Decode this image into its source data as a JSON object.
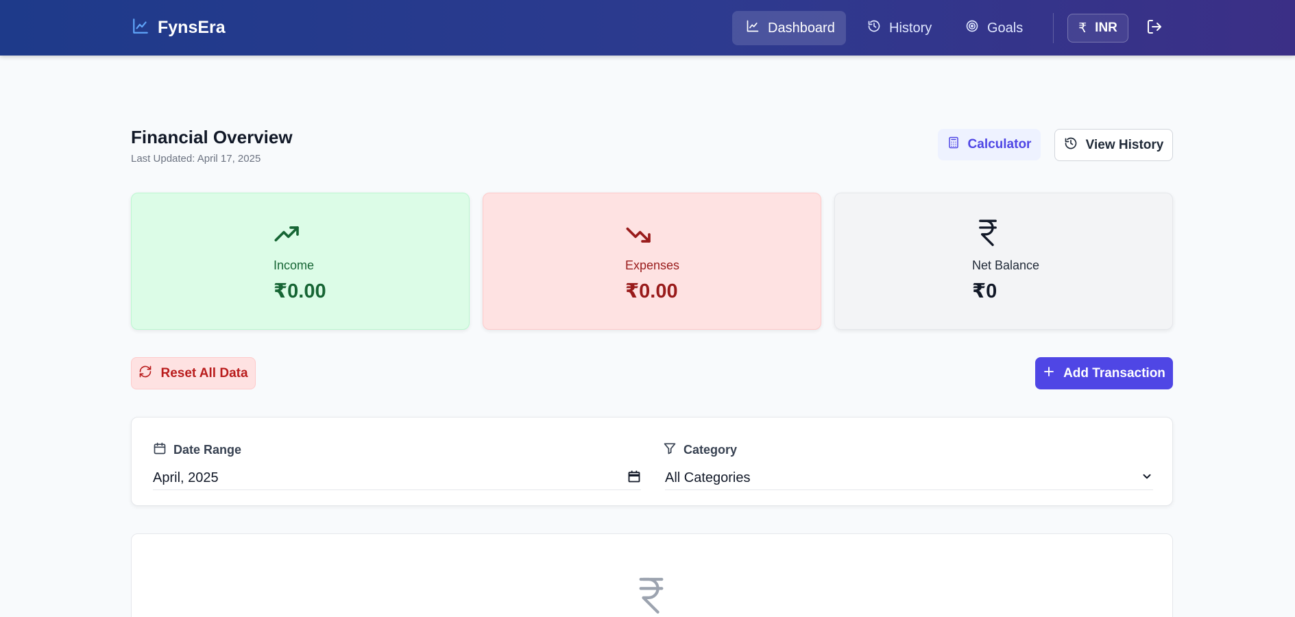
{
  "app": {
    "name": "FynsEra"
  },
  "nav": {
    "items": [
      {
        "label": "Dashboard",
        "icon": "line-chart-icon",
        "active": true
      },
      {
        "label": "History",
        "icon": "history-icon",
        "active": false
      },
      {
        "label": "Goals",
        "icon": "target-icon",
        "active": false
      }
    ],
    "currency": {
      "symbol": "₹",
      "code": "INR"
    },
    "logout_icon": "logout-icon"
  },
  "header": {
    "title": "Financial Overview",
    "last_updated": "Last Updated: April 17, 2025",
    "calculator_label": "Calculator",
    "view_history_label": "View History"
  },
  "summary": {
    "income": {
      "label": "Income",
      "value": "₹0.00",
      "color": "#166534",
      "icon": "trending-up-icon"
    },
    "expenses": {
      "label": "Expenses",
      "value": "₹0.00",
      "color": "#991b1b",
      "icon": "trending-down-icon"
    },
    "net_balance": {
      "label": "Net Balance",
      "value": "₹0",
      "color": "#111827",
      "icon": "rupee-icon"
    }
  },
  "actions": {
    "reset_label": "Reset All Data",
    "add_label": "Add Transaction"
  },
  "filters": {
    "date_range": {
      "label": "Date Range",
      "value": "April, 2025"
    },
    "category": {
      "label": "Category",
      "value": "All Categories"
    }
  },
  "colors": {
    "accent": "#4f46e5",
    "income_bg": "#dcfce7",
    "expense_bg": "#fee2e2",
    "balance_bg": "#f3f4f6"
  }
}
